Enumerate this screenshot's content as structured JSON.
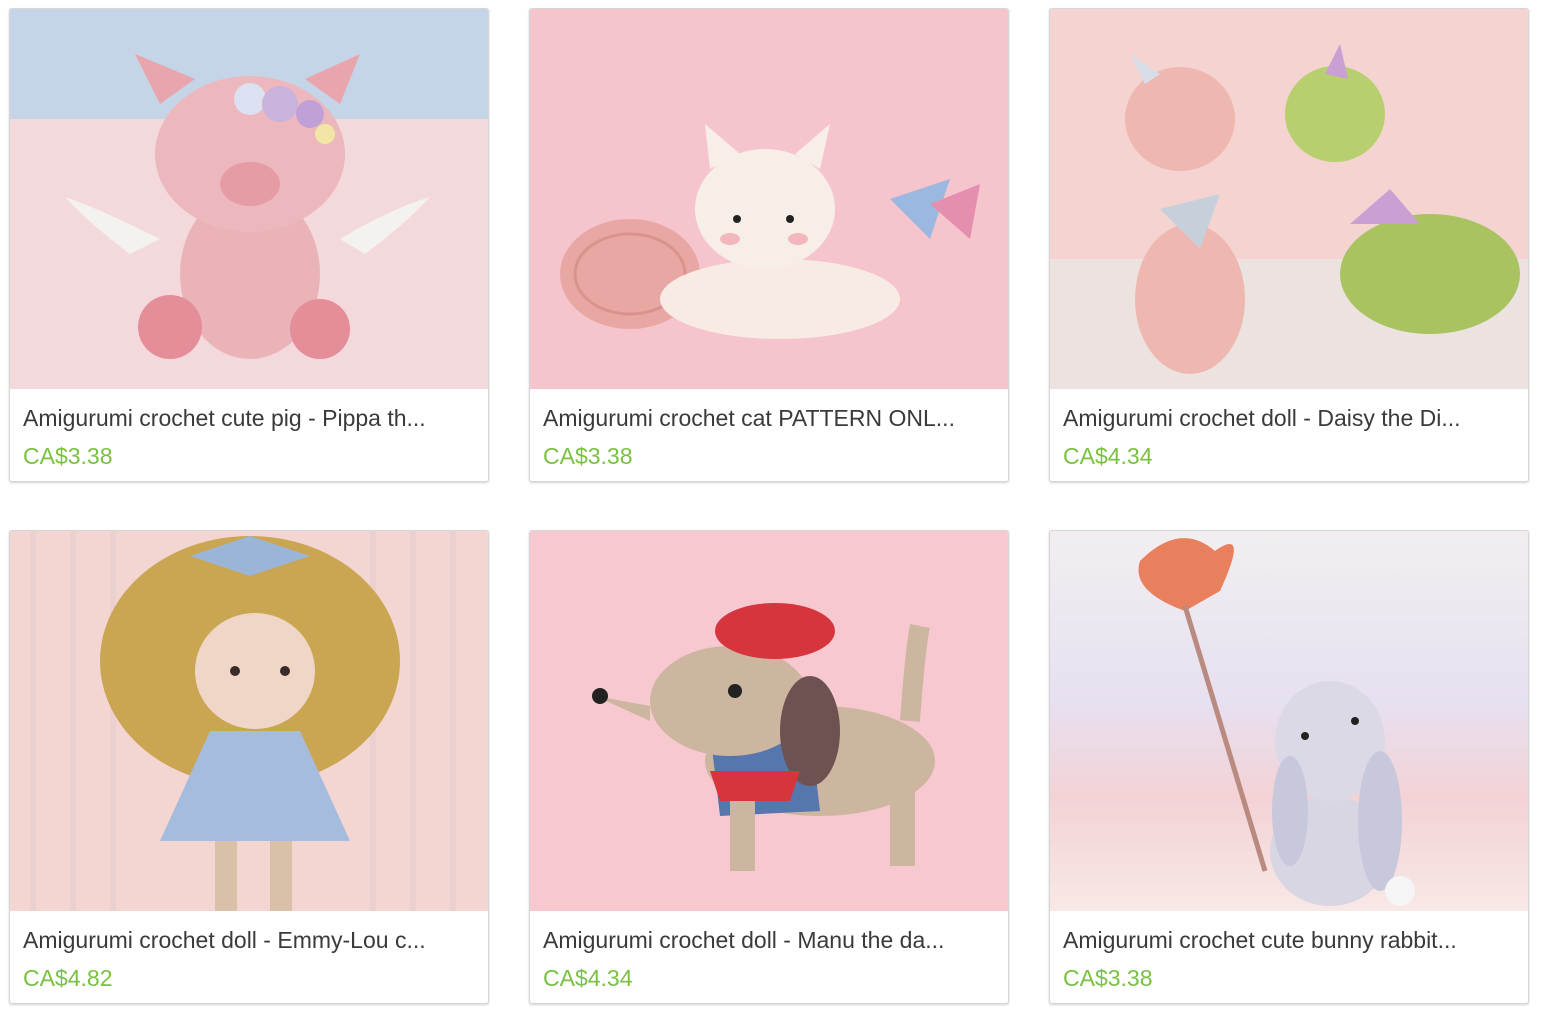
{
  "products": [
    {
      "title": "Amigurumi crochet cute pig - Pippa the flying pig PATTERN ONLY",
      "display_title": "Amigurumi crochet cute pig - Pippa th...",
      "price": "CA$3.38"
    },
    {
      "title": "Amigurumi crochet cat PATTERN ONLY",
      "display_title": "Amigurumi crochet cat PATTERN ONL...",
      "price": "CA$3.38"
    },
    {
      "title": "Amigurumi crochet doll - Daisy the Dino",
      "display_title": "Amigurumi crochet doll - Daisy the Di...",
      "price": "CA$4.34"
    },
    {
      "title": "Amigurumi crochet doll - Emmy-Lou crochet doll",
      "display_title": "Amigurumi crochet doll - Emmy-Lou c...",
      "price": "CA$4.82"
    },
    {
      "title": "Amigurumi crochet doll - Manu the dachshund",
      "display_title": "Amigurumi crochet doll - Manu the da...",
      "price": "CA$4.34"
    },
    {
      "title": "Amigurumi crochet cute bunny rabbit",
      "display_title": "Amigurumi crochet cute bunny rabbit...",
      "price": "CA$3.38"
    }
  ],
  "colors": {
    "price": "#7ac142",
    "title": "#3a3a3a",
    "card_border": "#d6d6d6"
  }
}
